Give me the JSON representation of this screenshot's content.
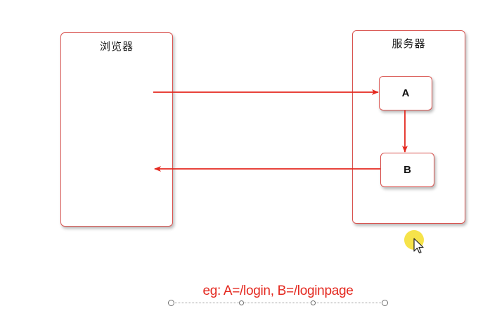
{
  "diagram": {
    "browser_label": "浏览器",
    "server_label": "服务器",
    "node_a_label": "A",
    "node_b_label": "B",
    "caption": "eg: A=/login, B=/loginpage"
  },
  "colors": {
    "accent_red": "#e4281f",
    "border_red": "#d9534f",
    "cursor_highlight": "#f6e240"
  },
  "icons": {
    "cursor": "mouse-pointer-icon"
  }
}
